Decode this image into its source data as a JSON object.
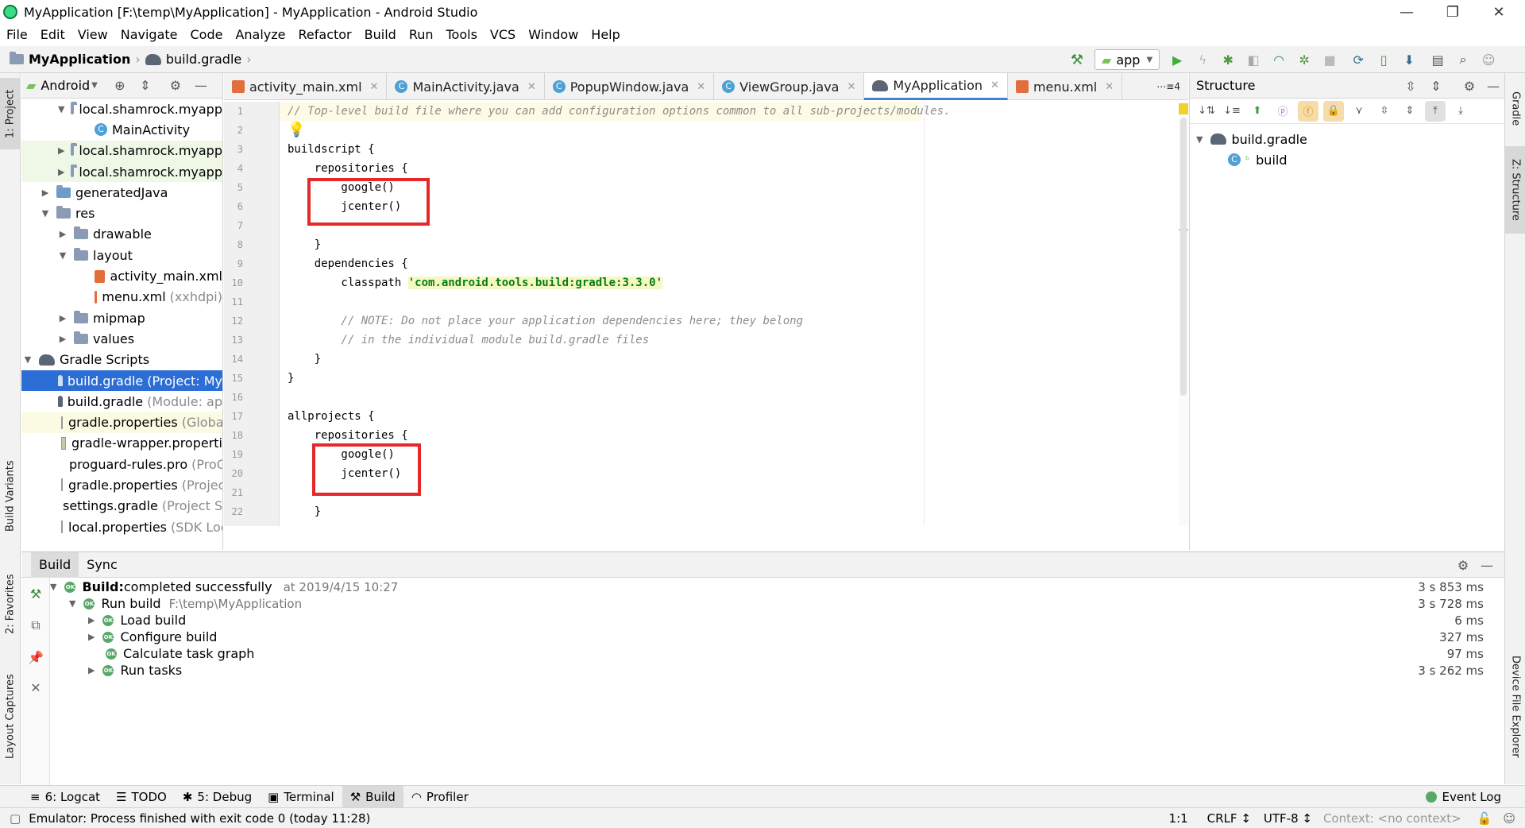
{
  "window": {
    "title": "MyApplication [F:\\temp\\MyApplication] - MyApplication - Android Studio",
    "controls": {
      "minimize": "—",
      "restore": "❐",
      "close": "✕"
    }
  },
  "menu": [
    "File",
    "Edit",
    "View",
    "Navigate",
    "Code",
    "Analyze",
    "Refactor",
    "Build",
    "Run",
    "Tools",
    "VCS",
    "Window",
    "Help"
  ],
  "nav": {
    "project": "MyApplication",
    "file": "build.gradle",
    "run_config": "app"
  },
  "left_stripe": {
    "project": "1: Project",
    "build_variants": "Build Variants",
    "favorites": "2: Favorites",
    "layout_captures": "Layout Captures"
  },
  "right_stripe": {
    "gradle": "Gradle",
    "structure": "Z: Structure",
    "device": "Device File Explorer"
  },
  "project_panel": {
    "view": "Android",
    "rows": [
      {
        "label": "local.shamrock.myapp",
        "extra": ""
      },
      {
        "label": "MainActivity",
        "extra": ""
      },
      {
        "label": "local.shamrock.myapp",
        "extra": ""
      },
      {
        "label": "local.shamrock.myapp",
        "extra": ""
      },
      {
        "label": "generatedJava",
        "extra": ""
      },
      {
        "label": "res",
        "extra": ""
      },
      {
        "label": "drawable",
        "extra": ""
      },
      {
        "label": "layout",
        "extra": ""
      },
      {
        "label": "activity_main.xml",
        "extra": ""
      },
      {
        "label": "menu.xml",
        "extra": "(xxhdpi)"
      },
      {
        "label": "mipmap",
        "extra": ""
      },
      {
        "label": "values",
        "extra": ""
      },
      {
        "label": "Gradle Scripts",
        "extra": ""
      },
      {
        "label": "build.gradle",
        "extra": "(Project: My"
      },
      {
        "label": "build.gradle",
        "extra": "(Module: ap"
      },
      {
        "label": "gradle.properties",
        "extra": "(Global"
      },
      {
        "label": "gradle-wrapper.properti",
        "extra": ""
      },
      {
        "label": "proguard-rules.pro",
        "extra": "(ProG"
      },
      {
        "label": "gradle.properties",
        "extra": "(Projec"
      },
      {
        "label": "settings.gradle",
        "extra": "(Project S"
      },
      {
        "label": "local.properties",
        "extra": "(SDK Loc"
      }
    ]
  },
  "editor": {
    "tabs": [
      "activity_main.xml",
      "MainActivity.java",
      "PopupWindow.java",
      "ViewGroup.java",
      "MyApplication",
      "menu.xml"
    ],
    "tab_count": "4",
    "lines": [
      "// Top-level build file where you can add configuration options common to all sub-projects/modules.",
      "",
      "buildscript {",
      "    repositories {",
      "        google()",
      "        jcenter()",
      "",
      "    }",
      "    dependencies {",
      "        classpath ",
      "",
      "        // NOTE: Do not place your application dependencies here; they belong",
      "        // in the individual module build.gradle files",
      "    }",
      "}",
      "",
      "allprojects {",
      "    repositories {",
      "        google()",
      "        jcenter()",
      "",
      "    }"
    ],
    "classpath_string": "'com.android.tools.build:gradle:3.3.0'",
    "line_numbers": [
      "1",
      "2",
      "3",
      "4",
      "5",
      "6",
      "7",
      "8",
      "9",
      "10",
      "11",
      "12",
      "13",
      "14",
      "15",
      "16",
      "17",
      "18",
      "19",
      "20",
      "21",
      "22"
    ]
  },
  "structure_panel": {
    "title": "Structure",
    "root": "build.gradle",
    "child": "build"
  },
  "build_panel": {
    "tabs": [
      "Build",
      "Sync"
    ],
    "rows": [
      {
        "bold": "Build:",
        "text": " completed successfully",
        "muted": "at 2019/4/15 10:27",
        "time": "3 s 853 ms"
      },
      {
        "bold": "",
        "text": "Run build",
        "muted": "F:\\temp\\MyApplication",
        "time": "3 s 728 ms"
      },
      {
        "bold": "",
        "text": "Load build",
        "muted": "",
        "time": "6 ms"
      },
      {
        "bold": "",
        "text": "Configure build",
        "muted": "",
        "time": "327 ms"
      },
      {
        "bold": "",
        "text": "Calculate task graph",
        "muted": "",
        "time": "97 ms"
      },
      {
        "bold": "",
        "text": "Run tasks",
        "muted": "",
        "time": "3 s 262 ms"
      }
    ]
  },
  "bottom_tabs": [
    "6: Logcat",
    "TODO",
    "5: Debug",
    "Terminal",
    "Build",
    "Profiler"
  ],
  "event_log": "Event Log",
  "status": {
    "message": "Emulator: Process finished with exit code 0 (today 11:28)",
    "position": "1:1",
    "line_sep": "CRLF ↕",
    "encoding": "UTF-8 ↕",
    "context": "Context: <no context>"
  }
}
